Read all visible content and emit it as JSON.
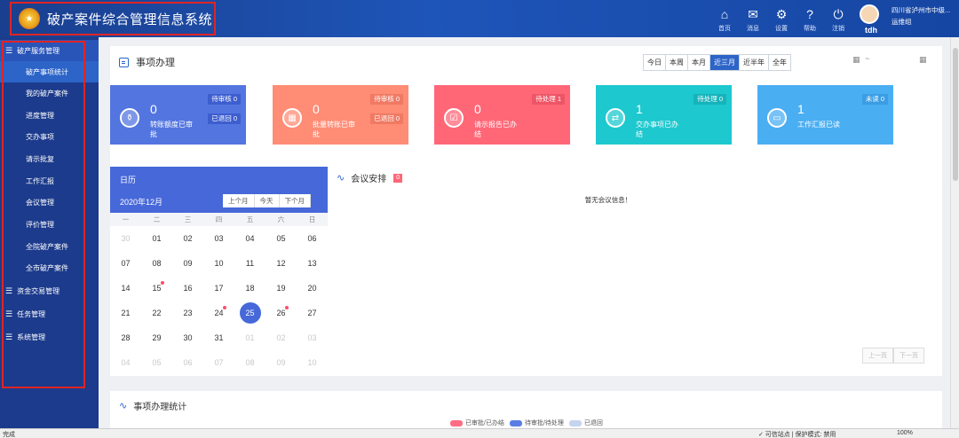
{
  "header": {
    "title": "破产案件综合管理信息系统",
    "emblem_icon": "court-emblem-icon",
    "nav": [
      {
        "label": "首页",
        "icon": "home-icon",
        "glyph": "⌂"
      },
      {
        "label": "消息",
        "icon": "mail-icon",
        "glyph": "✉"
      },
      {
        "label": "设置",
        "icon": "gear-icon",
        "glyph": "⚙"
      },
      {
        "label": "帮助",
        "icon": "help-icon",
        "glyph": "?"
      },
      {
        "label": "注销",
        "icon": "power-icon",
        "glyph": "⏻"
      }
    ],
    "username": "tdh",
    "org_line1": "四川省泸州市中级...",
    "org_line2": "运维组"
  },
  "sidebar": {
    "groups": [
      {
        "label": "破产服务管理",
        "active": true
      },
      {
        "label": "资金交易管理"
      },
      {
        "label": "任务管理"
      },
      {
        "label": "系统管理"
      }
    ],
    "items": [
      {
        "label": "破产事项统计",
        "selected": true
      },
      {
        "label": "我的破产案件"
      },
      {
        "label": "进度管理"
      },
      {
        "label": "交办事项"
      },
      {
        "label": "请示批复"
      },
      {
        "label": "工作汇报"
      },
      {
        "label": "会议管理"
      },
      {
        "label": "评价管理"
      },
      {
        "label": "全院破产案件"
      },
      {
        "label": "全市破产案件"
      }
    ]
  },
  "affairs": {
    "title": "事项办理",
    "ranges": [
      "今日",
      "本周",
      "本月",
      "近三月",
      "近半年",
      "全年"
    ],
    "active_range": "近三月",
    "date_sep": "~",
    "cards": [
      {
        "count": "0",
        "label": "转账额度已审批",
        "icon": "money-bag-icon",
        "glyph": "⚱",
        "tags": [
          "待审核 0",
          "已退回 0"
        ]
      },
      {
        "count": "0",
        "label": "批量转账已审批",
        "icon": "grid-icon",
        "glyph": "▦",
        "tags": [
          "待审核 0",
          "已退回 0"
        ]
      },
      {
        "count": "0",
        "label": "请示报告已办结",
        "icon": "report-icon",
        "glyph": "☑",
        "tags": [
          "待处理 1"
        ]
      },
      {
        "count": "1",
        "label": "交办事项已办结",
        "icon": "exchange-icon",
        "glyph": "⇄",
        "tags": [
          "待处理 0"
        ]
      },
      {
        "count": "1",
        "label": "工作汇报已读",
        "icon": "chat-icon",
        "glyph": "▭",
        "tags": [
          "未读 0"
        ]
      }
    ]
  },
  "calendar": {
    "title": "日历",
    "month": "2020年12月",
    "nav": [
      "上个月",
      "今天",
      "下个月"
    ],
    "weekdays": [
      "一",
      "二",
      "三",
      "四",
      "五",
      "六",
      "日"
    ],
    "weeks": [
      [
        "30",
        "01",
        "02",
        "03",
        "04",
        "05",
        "06"
      ],
      [
        "07",
        "08",
        "09",
        "10",
        "11",
        "12",
        "13"
      ],
      [
        "14",
        "15",
        "16",
        "17",
        "18",
        "19",
        "20"
      ],
      [
        "21",
        "22",
        "23",
        "24",
        "25",
        "26",
        "27"
      ],
      [
        "28",
        "29",
        "30",
        "31",
        "01",
        "02",
        "03"
      ],
      [
        "04",
        "05",
        "06",
        "07",
        "08",
        "09",
        "10"
      ]
    ],
    "today": "25",
    "dot_days": [
      "15",
      "24",
      "26"
    ]
  },
  "meetings": {
    "title": "会议安排",
    "badge": "0",
    "empty_text": "暂无会议信息！",
    "prev": "上一页",
    "next": "下一页"
  },
  "stats": {
    "title": "事项办理统计",
    "legend": [
      {
        "label": "已审批/已办结",
        "color": "#ff6d84"
      },
      {
        "label": "待审批/待处理",
        "color": "#5b7ee5"
      },
      {
        "label": "已退回",
        "color": "#c5d3ef"
      }
    ]
  },
  "statusbar": {
    "left": "完成",
    "right": "✓ 可信站点 | 保护模式: 禁用",
    "zoom": "100%"
  }
}
